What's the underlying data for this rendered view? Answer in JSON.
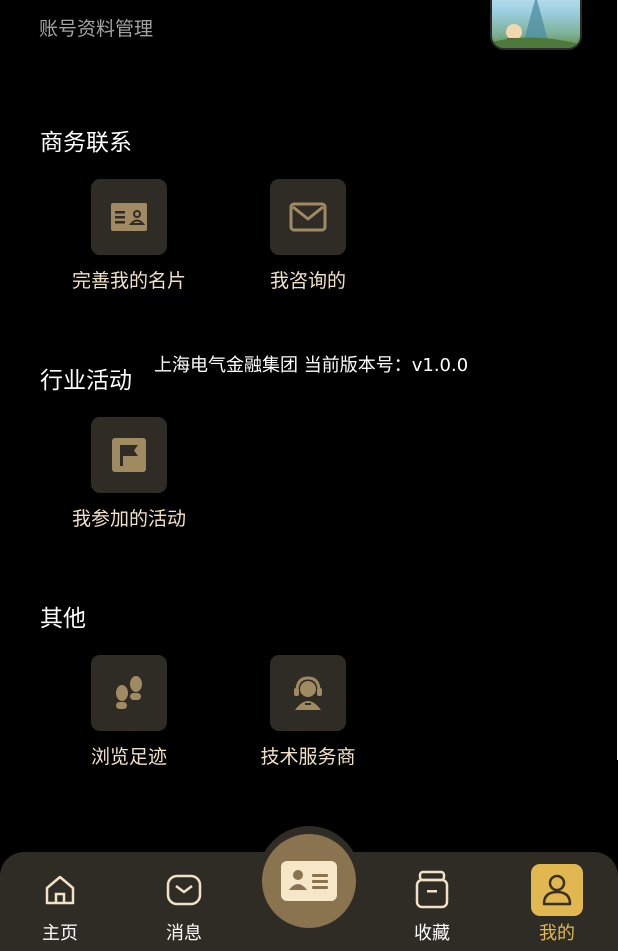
{
  "header": {
    "account_link": "账号资料管理"
  },
  "sections": [
    {
      "title": "商务联系",
      "items": [
        {
          "label": "完善我的名片",
          "icon": "business-card-icon"
        },
        {
          "label": "我咨询的",
          "icon": "mail-icon"
        }
      ]
    },
    {
      "title": "行业活动",
      "items": [
        {
          "label": "我参加的活动",
          "icon": "flag-icon"
        }
      ]
    },
    {
      "title": "其他",
      "items": [
        {
          "label": "浏览足迹",
          "icon": "footprints-icon"
        },
        {
          "label": "技术服务商",
          "icon": "support-agent-icon"
        }
      ]
    }
  ],
  "version_text": "上海电气金融集团 当前版本号：v1.0.0",
  "tabbar": {
    "tabs": [
      {
        "label": "主页",
        "icon": "home-icon"
      },
      {
        "label": "消息",
        "icon": "message-icon"
      },
      {
        "label": "收藏",
        "icon": "archive-box-icon"
      },
      {
        "label": "我的",
        "icon": "user-icon",
        "active": true
      }
    ],
    "center_icon": "id-card-icon"
  },
  "colors": {
    "background": "#000000",
    "tile_bg": "#2f2c26",
    "icon_gold": "#a08a62",
    "label_cream": "#f1e2c7",
    "active_gold": "#e0b84f",
    "center_button": "#8a7450"
  }
}
